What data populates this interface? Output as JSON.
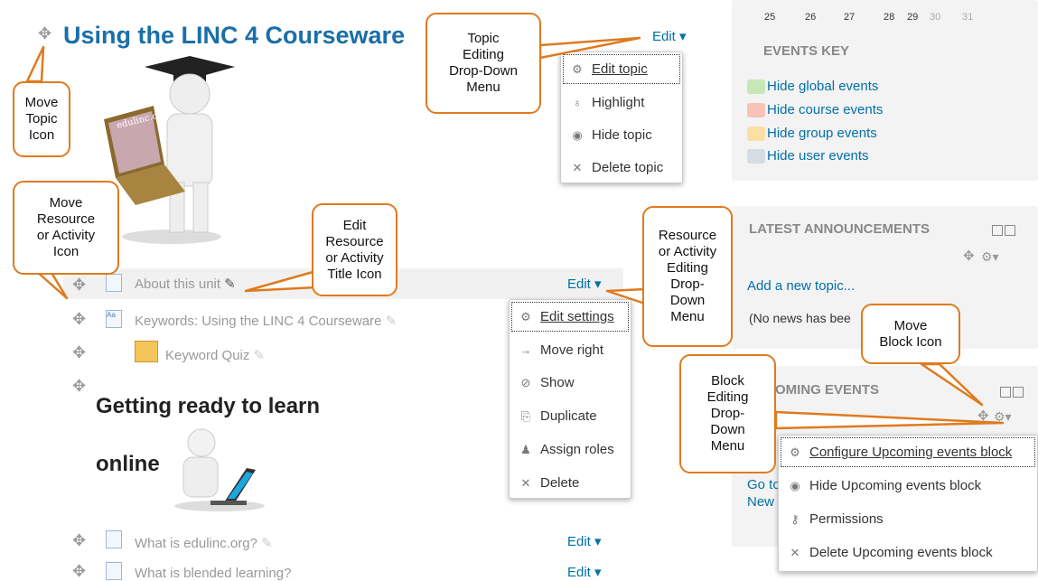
{
  "topic": {
    "title": "Using the LINC 4 Courseware",
    "edit_label": "Edit",
    "menu": [
      "Edit topic",
      "Highlight",
      "Hide topic",
      "Delete topic"
    ]
  },
  "resources": [
    {
      "label": "About this unit",
      "edit": "Edit"
    },
    {
      "label": "Keywords: Using the LINC 4 Courseware"
    },
    {
      "label": "Keyword Quiz"
    },
    {
      "label": "What is edulinc.org?",
      "edit": "Edit"
    },
    {
      "label": "What is blended learning?",
      "edit": "Edit"
    }
  ],
  "section2": {
    "title_line1": "Getting ready to learn",
    "title_line2": "online"
  },
  "resource_menu": [
    "Edit settings",
    "Move right",
    "Show",
    "Duplicate",
    "Assign roles",
    "Delete"
  ],
  "calendar": {
    "days": [
      "25",
      "26",
      "27",
      "28",
      "29",
      "30",
      "31"
    ]
  },
  "events_key": {
    "title": "EVENTS KEY",
    "items": [
      {
        "label": "Hide global events",
        "color": "#c6e8b8"
      },
      {
        "label": "Hide course events",
        "color": "#f7c3b6"
      },
      {
        "label": "Hide group events",
        "color": "#fbe0a3"
      },
      {
        "label": "Hide user events",
        "color": "#d5dce4"
      }
    ]
  },
  "announcements": {
    "title": "LATEST ANNOUNCEMENTS",
    "add_link": "Add a new topic...",
    "no_news": "(No news has bee"
  },
  "upcoming": {
    "title": "OMING EVENTS",
    "goto": "Go to",
    "new": "New",
    "menu": [
      "Configure Upcoming events block",
      "Hide Upcoming events block",
      "Permissions",
      "Delete Upcoming events block"
    ]
  },
  "callouts": {
    "move_topic": "Move\nTopic\nIcon",
    "topic_menu": "Topic\nEditing\nDrop-Down\nMenu",
    "move_resource": "Move\nResource\nor Activity\nIcon",
    "edit_title": "Edit\nResource\nor Activity\nTitle Icon",
    "resource_menu": "Resource\nor Activity\nEditing\nDrop-\nDown\nMenu",
    "move_block": "Move\nBlock Icon",
    "block_menu": "Block\nEditing\nDrop-\nDown\nMenu"
  },
  "colors": {
    "accent": "#1a6fa8",
    "callout_border": "#e07a1f"
  }
}
